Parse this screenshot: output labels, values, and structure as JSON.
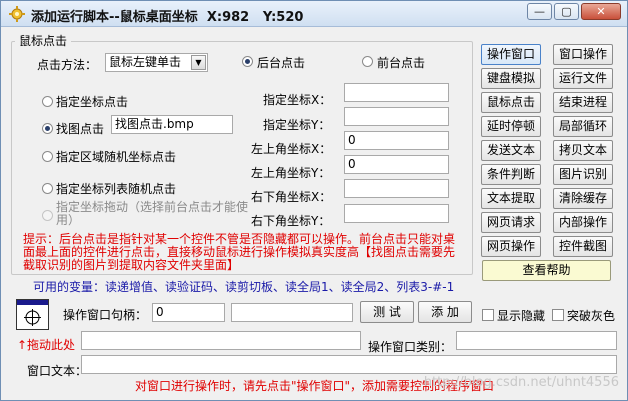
{
  "window": {
    "title": "添加运行脚本--鼠标桌面坐标",
    "coord_x_label": "X:",
    "coord_x": "982",
    "coord_y_label": "Y:",
    "coord_y": "520",
    "minimize": "—",
    "maximize": "▢",
    "close": "✕"
  },
  "group": {
    "title": "鼠标点击"
  },
  "click": {
    "method_label": "点击方法：",
    "method_value": "鼠标左键单击",
    "background_label": "后台点击",
    "foreground_label": "前台点击"
  },
  "modes": [
    {
      "label": "指定坐标点击",
      "checked": false
    },
    {
      "label": "找图点击",
      "checked": true,
      "value": "找图点击.bmp"
    },
    {
      "label": "指定区域随机坐标点击",
      "checked": false
    },
    {
      "label": "指定坐标列表随机点击",
      "checked": false
    },
    {
      "label": "指定坐标拖动（选择前台点击才能使用）",
      "checked": false,
      "disabled": true
    }
  ],
  "fields": [
    {
      "label": "指定坐标X：",
      "value": ""
    },
    {
      "label": "指定坐标Y：",
      "value": ""
    },
    {
      "label": "左上角坐标X：",
      "value": "0"
    },
    {
      "label": "左上角坐标Y：",
      "value": "0"
    },
    {
      "label": "右下角坐标X：",
      "value": ""
    },
    {
      "label": "右下角坐标Y：",
      "value": ""
    }
  ],
  "hint": "提示：后台点击是指针对某一个控件不管是否隐藏都可以操作。前台点击只能对桌面最上面的控件进行点击，直接移动鼠标进行操作模拟真实度高【找图点击需要先截取识别的图片到提取内容文件夹里面】",
  "variables": "可用的变量：读递增值、读验证码、读剪切板、读全局1、读全局2、列表3-#-1",
  "side_buttons": [
    {
      "label": "操作窗口",
      "active": true
    },
    {
      "label": "窗口操作"
    },
    {
      "label": "键盘模拟"
    },
    {
      "label": "运行文件"
    },
    {
      "label": "鼠标点击"
    },
    {
      "label": "结束进程"
    },
    {
      "label": "延时停顿"
    },
    {
      "label": "局部循环"
    },
    {
      "label": "发送文本"
    },
    {
      "label": "拷贝文本"
    },
    {
      "label": "条件判断"
    },
    {
      "label": "图片识别"
    },
    {
      "label": "文本提取"
    },
    {
      "label": "清除缓存"
    },
    {
      "label": "网页请求"
    },
    {
      "label": "内部操作"
    },
    {
      "label": "网页操作"
    },
    {
      "label": "控件截图"
    }
  ],
  "help_button": "查看帮助",
  "bottom": {
    "handle_label": "操作窗口句柄：",
    "handle_value": "0",
    "test_button": "测 试",
    "add_button": "添 加",
    "show_hidden": "显示隐藏",
    "break_gray": "突破灰色",
    "drag_here": "↑拖动此处",
    "window_class_label": "操作窗口类别：",
    "window_text_label": "窗口文本：",
    "footer_note": "对窗口进行操作时，请先点击\"操作窗口\"，添加需要控制的程序窗口"
  },
  "watermark": "http://blog.csdn.net/uhnt4556",
  "colors": {
    "hint_red": "#e00000",
    "variables_blue": "#1a1aa8",
    "help_yellow": "#fafad2"
  }
}
